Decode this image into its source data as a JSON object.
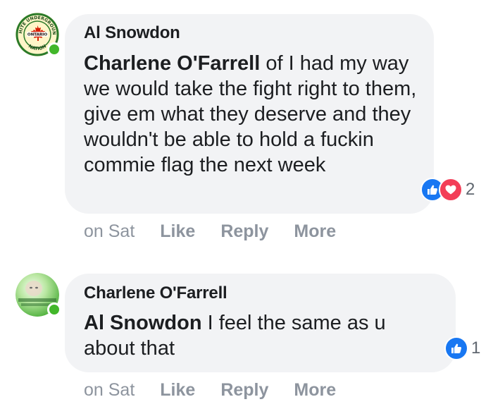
{
  "comments": [
    {
      "author": "Al Snowdon",
      "mention": "Charlene O'Farrell",
      "text": " of I had my way we would take the fight right to them, give em what they deserve and they wouldn't be able to hold a fuckin commie flag the next week",
      "reactions": [
        "like-icon",
        "love-icon"
      ],
      "reaction_count": "2",
      "timestamp": "on Sat",
      "actions": {
        "like": "Like",
        "reply": "Reply",
        "more": "More"
      },
      "avatar_badge_lines": [
        "WHITE UNDERGROUND",
        "ONTARIO",
        "NATION"
      ]
    },
    {
      "author": "Charlene O'Farrell",
      "mention": "Al Snowdon",
      "text": " I feel the same as u about that",
      "reactions": [
        "like-icon"
      ],
      "reaction_count": "1",
      "timestamp": "on Sat",
      "actions": {
        "like": "Like",
        "reply": "Reply",
        "more": "More"
      }
    }
  ],
  "colors": {
    "bubble": "#f2f3f5",
    "text": "#1c1e21",
    "muted": "#8d949e",
    "like": "#1877f2",
    "love": "#f33e58",
    "online": "#42b72a"
  }
}
